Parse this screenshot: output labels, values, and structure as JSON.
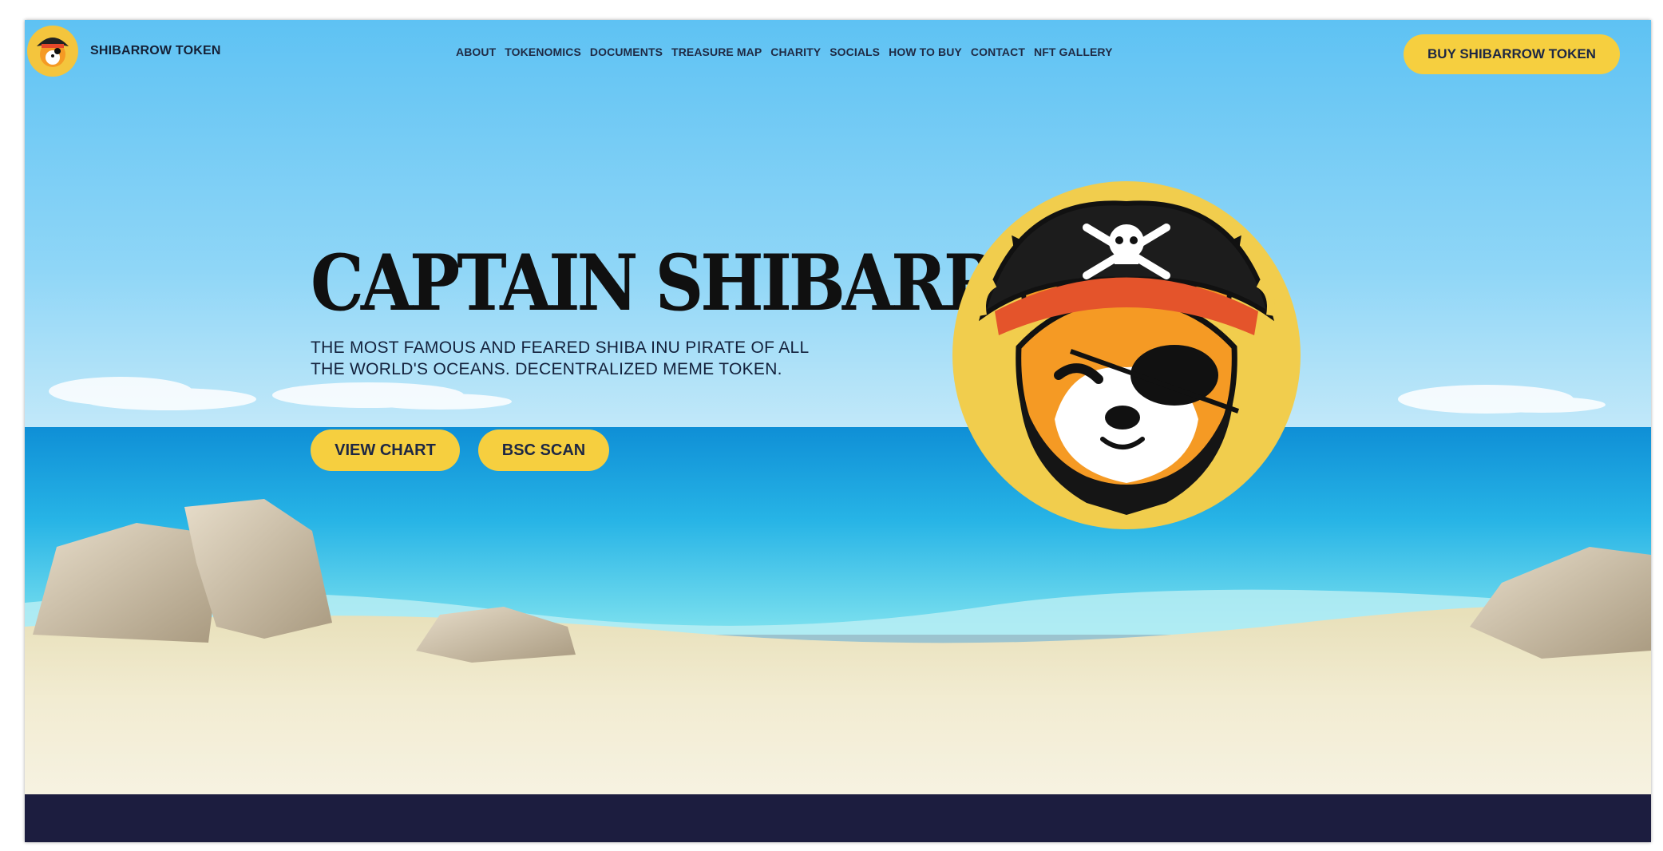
{
  "brand": {
    "name": "SHIBARROW TOKEN"
  },
  "nav": {
    "links": [
      "ABOUT",
      "TOKENOMICS",
      "DOCUMENTS",
      "TREASURE MAP",
      "CHARITY",
      "SOCIALS",
      "HOW TO BUY",
      "CONTACT",
      "NFT GALLERY"
    ],
    "cta_label": "BUY SHIBARROW TOKEN"
  },
  "hero": {
    "title": "CAPTAIN SHIBARROW",
    "subtitle_line1": "THE MOST FAMOUS AND FEARED SHIBA INU PIRATE OF ALL",
    "subtitle_line2": "THE WORLD'S OCEANS. DECENTRALIZED MEME TOKEN.",
    "buttons": {
      "chart": "VIEW CHART",
      "bsc": "BSC SCAN"
    }
  },
  "colors": {
    "accent": "#f6cf3f",
    "nav_text": "#1f2a44",
    "footer": "#1c1d3f",
    "sky": "#5fc1f1",
    "sea": "#1fa7e2",
    "sand": "#efe9cf"
  },
  "icons": {
    "mascot": "pirate-shiba-icon",
    "logo": "pirate-shiba-logo-icon"
  }
}
